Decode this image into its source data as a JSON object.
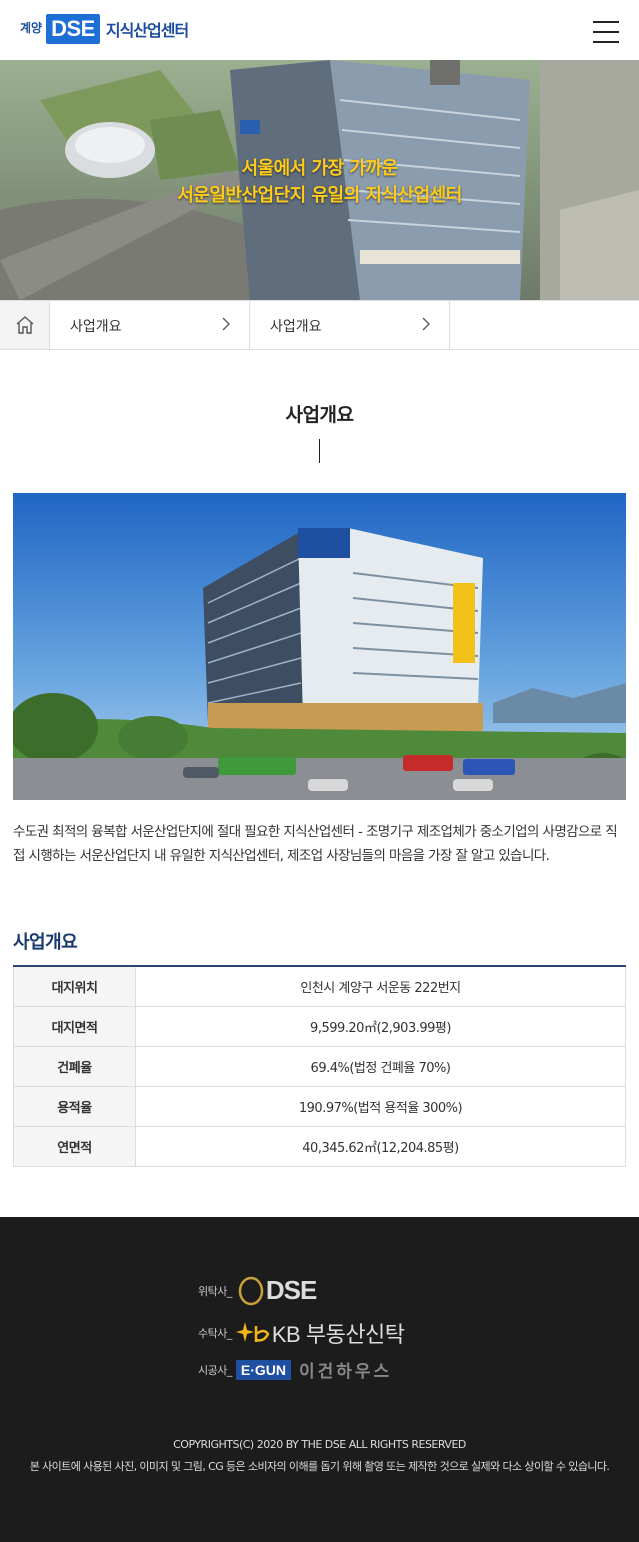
{
  "header": {
    "logo_prefix": "계양",
    "logo_mark": "DSE",
    "logo_name": "지식산업센터",
    "menu_icon": "hamburger-menu-icon"
  },
  "hero": {
    "line1": "서울에서 가장 가까운",
    "line2": "서운일반산업단지 유일의 지식산업센터"
  },
  "breadcrumb": {
    "home_icon": "home-icon",
    "items": [
      {
        "label": "사업개요"
      },
      {
        "label": "사업개요"
      }
    ]
  },
  "page": {
    "title": "사업개요",
    "description": "수도권 최적의 융복합 서운산업단지에 절대 필요한 지식산업센터 - 조명기구 제조업체가 중소기업의 사명감으로 직접 시행하는 서운산업단지 내 유일한 지식산업센터, 제조업 사장님들의 마음을 가장 잘 알고 있습니다."
  },
  "overview": {
    "title": "사업개요",
    "rows": [
      {
        "label": "대지위치",
        "value": "인천시 계양구 서운동 222번지"
      },
      {
        "label": "대지면적",
        "value": "9,599.20㎡(2,903.99평)"
      },
      {
        "label": "건폐율",
        "value": "69.4%(법정 건폐율 70%)"
      },
      {
        "label": "용적율",
        "value": "190.97%(법적 용적율 300%)"
      },
      {
        "label": "연면적",
        "value": "40,345.62㎡(12,204.85평)"
      }
    ]
  },
  "footer": {
    "trustor_label": "위탁사_",
    "trustor_name": "DSE",
    "trustee_label": "수탁사_",
    "trustee_name": "KB 부동산신탁",
    "builder_label": "시공사_",
    "builder_mark": "E·GUN",
    "builder_name": "이건하우스",
    "copyright": "COPYRIGHTS(C) 2020 BY THE DSE ALL RIGHTS RESERVED",
    "notice": "본 사이트에 사용된 사진, 이미지 및 그림, CG 등은 소비자의 이해를 돕기 위해 촬영 또는 제작한 것으로 실제와 다소 상이할 수 있습니다."
  },
  "colors": {
    "brand_blue": "#1d6fd6",
    "hero_text": "#ffcc1a",
    "section_title": "#1a3a6b",
    "footer_bg": "#1c1c1c"
  }
}
